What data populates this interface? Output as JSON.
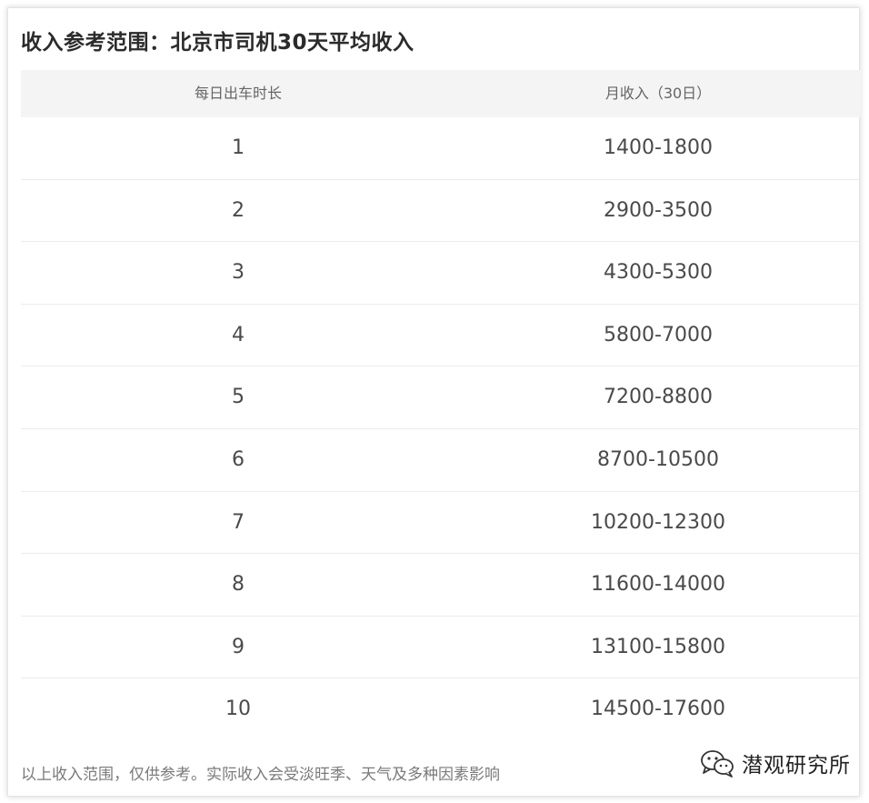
{
  "title": "收入参考范围：北京市司机30天平均收入",
  "table": {
    "headers": [
      "每日出车时长",
      "月收入（30日）"
    ],
    "rows": [
      [
        "1",
        "1400-1800"
      ],
      [
        "2",
        "2900-3500"
      ],
      [
        "3",
        "4300-5300"
      ],
      [
        "4",
        "5800-7000"
      ],
      [
        "5",
        "7200-8800"
      ],
      [
        "6",
        "8700-10500"
      ],
      [
        "7",
        "10200-12300"
      ],
      [
        "8",
        "11600-14000"
      ],
      [
        "9",
        "13100-15800"
      ],
      [
        "10",
        "14500-17600"
      ]
    ]
  },
  "footer": "以上收入范围，仅供参考。实际收入会受淡旺季、天气及多种因素影响",
  "watermark": {
    "icon": "wechat-icon",
    "text": "潜观研究所"
  }
}
